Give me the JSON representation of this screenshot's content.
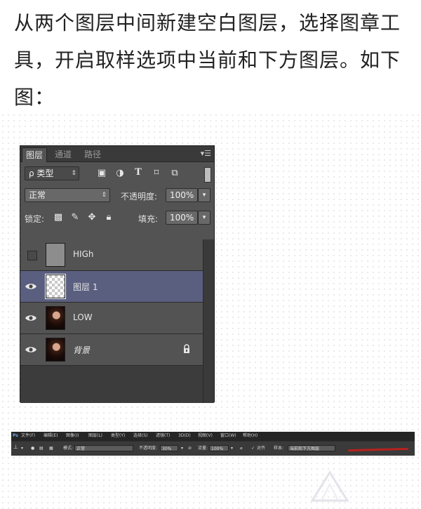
{
  "instruction": "从两个图层中间新建空白图层，选择图章工具，开启取样选项中当前和下方图层。如下图：",
  "panel": {
    "tabs": [
      "图层",
      "通道",
      "路径"
    ],
    "filter_label": "ρ 类型",
    "blend_mode": "正常",
    "opacity_label": "不透明度:",
    "opacity_value": "100%",
    "lock_label": "锁定:",
    "fill_label": "填充:",
    "fill_value": "100%",
    "layers": [
      {
        "name": "HIGh",
        "visible": false,
        "thumb": "gray"
      },
      {
        "name": "图层 1",
        "visible": true,
        "thumb": "transparent",
        "selected": true
      },
      {
        "name": "LOW",
        "visible": true,
        "thumb": "photo"
      },
      {
        "name": "背景",
        "visible": true,
        "thumb": "photo",
        "locked": true
      }
    ]
  },
  "toolbar": {
    "menu": [
      "文件(F)",
      "编辑(E)",
      "图像(I)",
      "图层(L)",
      "类型(Y)",
      "选择(S)",
      "滤镜(T)",
      "3D(D)",
      "视图(V)",
      "窗口(W)",
      "帮助(H)"
    ],
    "mode_label": "模式:",
    "mode_value": "正常",
    "opacity_label": "不透明度:",
    "opacity_value": "30%",
    "flow_label": "流量:",
    "flow_value": "100%",
    "align_label": "对齐",
    "sample_label": "样本:",
    "sample_value": "当前和下方图层"
  }
}
